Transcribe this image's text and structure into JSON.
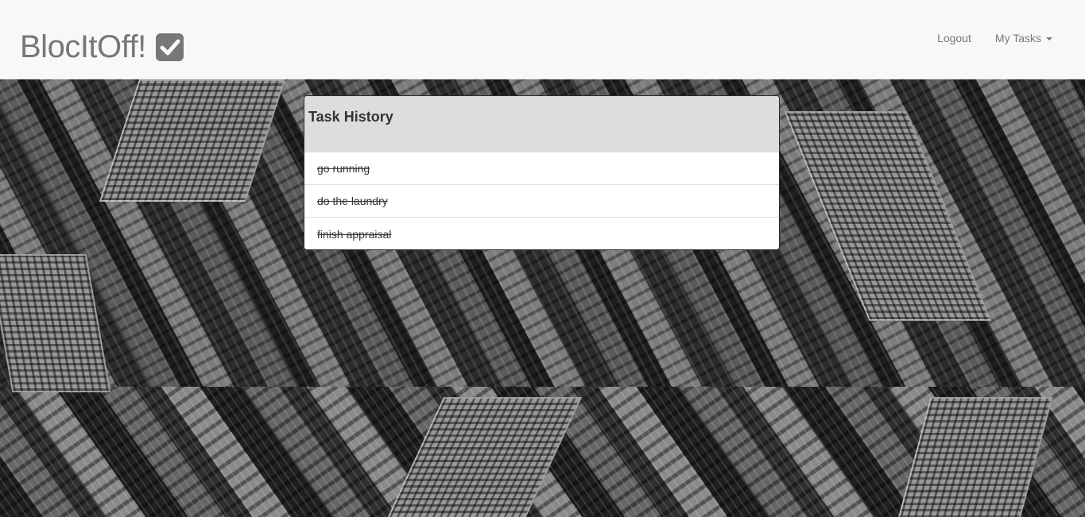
{
  "navbar": {
    "brand": "BlocItOff!",
    "brand_icon": "check-square-icon",
    "links": [
      {
        "label": "Logout"
      },
      {
        "label": "My Tasks",
        "has_dropdown": true
      }
    ]
  },
  "panel": {
    "title": "Task History",
    "tasks": [
      {
        "label": "go running",
        "completed": true
      },
      {
        "label": "do the laundry",
        "completed": true
      },
      {
        "label": "finish appraisal",
        "completed": true
      }
    ]
  },
  "background": {
    "description_icon": "city-aerial-photo"
  },
  "colors": {
    "navbar_bg": "#f8f8f8",
    "navbar_text": "#777777",
    "panel_heading_bg": "#dddddd",
    "panel_border": "#2b2b2b",
    "text": "#333333"
  }
}
